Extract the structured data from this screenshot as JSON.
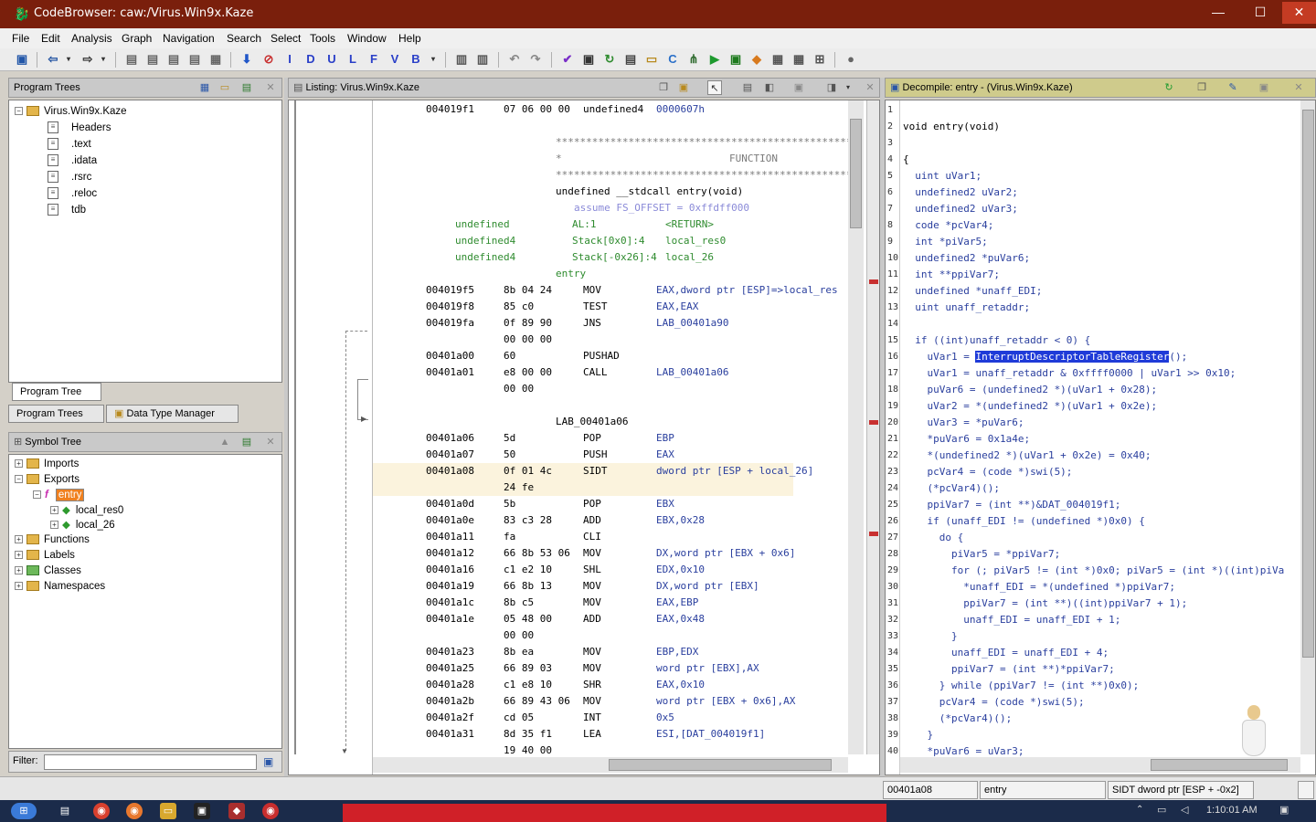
{
  "window": {
    "title": "CodeBrowser: caw:/Virus.Win9x.Kaze",
    "min_glyph": "—",
    "max_glyph": "☐",
    "close_glyph": "✕"
  },
  "menu": [
    "File",
    "Edit",
    "Analysis",
    "Graph",
    "Navigation",
    "Search",
    "Select",
    "Tools",
    "Window",
    "Help"
  ],
  "toolbar_letters": [
    "I",
    "D",
    "U",
    "L",
    "F",
    "V",
    "B"
  ],
  "program_trees": {
    "header": "Program Trees",
    "root": "Virus.Win9x.Kaze",
    "items": [
      "Headers",
      ".text",
      ".idata",
      ".rsrc",
      ".reloc",
      "tdb"
    ],
    "tab_program_tree": "Program Tree",
    "tab_program_trees": "Program Trees",
    "tab_data_type_manager": "Data Type Manager"
  },
  "symbol_tree": {
    "header": "Symbol Tree",
    "imports": "Imports",
    "exports": "Exports",
    "entry": "entry",
    "local1": "local_res0",
    "local2": "local_26",
    "functions": "Functions",
    "labels": "Labels",
    "classes": "Classes",
    "namespaces": "Namespaces",
    "filter_label": "Filter:"
  },
  "listing": {
    "header": "Listing:  Virus.Win9x.Kaze",
    "r0_addr": "004019f1",
    "r0_bytes": "07 06 00 00",
    "r0_mn": "undefined4",
    "r0_op": "0000607h",
    "stars": "****************************************************",
    "func_word": "FUNCTION",
    "sig": "undefined __stdcall entry(void)",
    "assume": "assume FS_OFFSET = 0xffdff000",
    "p1_type": "undefined",
    "p1_loc": "AL:1",
    "p1_name": "<RETURN>",
    "p2_type": "undefined4",
    "p2_loc": "Stack[0x0]:4",
    "p2_name": "local_res0",
    "p3_type": "undefined4",
    "p3_loc": "Stack[-0x26]:4",
    "p3_name": "local_26",
    "entry_label": "entry",
    "lab_label": "LAB_00401a06",
    "rows": [
      {
        "a": "004019f5",
        "b": "8b 04 24",
        "m": "MOV",
        "o": "EAX,dword ptr [ESP]=>local_res"
      },
      {
        "a": "004019f8",
        "b": "85 c0",
        "m": "TEST",
        "o": "EAX,EAX"
      },
      {
        "a": "004019fa",
        "b": "0f 89 90",
        "m": "JNS",
        "o": "LAB_00401a90"
      },
      {
        "a": "",
        "b": "00 00 00",
        "m": "",
        "o": ""
      },
      {
        "a": "00401a00",
        "b": "60",
        "m": "PUSHAD",
        "o": ""
      },
      {
        "a": "00401a01",
        "b": "e8 00 00",
        "m": "CALL",
        "o": "LAB_00401a06"
      },
      {
        "a": "",
        "b": "00 00",
        "m": "",
        "o": ""
      },
      {
        "a": "00401a06",
        "b": "5d",
        "m": "POP",
        "o": "EBP"
      },
      {
        "a": "00401a07",
        "b": "50",
        "m": "PUSH",
        "o": "EAX"
      },
      {
        "a": "00401a08",
        "b": "0f 01 4c",
        "m": "SIDT",
        "o": "dword ptr [ESP + local_26]"
      },
      {
        "a": "",
        "b": "24 fe",
        "m": "",
        "o": ""
      },
      {
        "a": "00401a0d",
        "b": "5b",
        "m": "POP",
        "o": "EBX"
      },
      {
        "a": "00401a0e",
        "b": "83 c3 28",
        "m": "ADD",
        "o": "EBX,0x28"
      },
      {
        "a": "00401a11",
        "b": "fa",
        "m": "CLI",
        "o": ""
      },
      {
        "a": "00401a12",
        "b": "66 8b 53 06",
        "m": "MOV",
        "o": "DX,word ptr [EBX + 0x6]"
      },
      {
        "a": "00401a16",
        "b": "c1 e2 10",
        "m": "SHL",
        "o": "EDX,0x10"
      },
      {
        "a": "00401a19",
        "b": "66 8b 13",
        "m": "MOV",
        "o": "DX,word ptr [EBX]"
      },
      {
        "a": "00401a1c",
        "b": "8b c5",
        "m": "MOV",
        "o": "EAX,EBP"
      },
      {
        "a": "00401a1e",
        "b": "05 48 00",
        "m": "ADD",
        "o": "EAX,0x48"
      },
      {
        "a": "",
        "b": "00 00",
        "m": "",
        "o": ""
      },
      {
        "a": "00401a23",
        "b": "8b ea",
        "m": "MOV",
        "o": "EBP,EDX"
      },
      {
        "a": "00401a25",
        "b": "66 89 03",
        "m": "MOV",
        "o": "word ptr [EBX],AX"
      },
      {
        "a": "00401a28",
        "b": "c1 e8 10",
        "m": "SHR",
        "o": "EAX,0x10"
      },
      {
        "a": "00401a2b",
        "b": "66 89 43 06",
        "m": "MOV",
        "o": "word ptr [EBX + 0x6],AX"
      },
      {
        "a": "00401a2f",
        "b": "cd 05",
        "m": "INT",
        "o": "0x5"
      },
      {
        "a": "00401a31",
        "b": "8d 35 f1",
        "m": "LEA",
        "o": "ESI,[DAT_004019f1]"
      },
      {
        "a": "",
        "b": "19 40 00",
        "m": "",
        "o": ""
      }
    ]
  },
  "decompile": {
    "header": "Decompile: entry -  (Virus.Win9x.Kaze)",
    "sel_text": "InterruptDescriptorTableRegister",
    "lines": [
      "",
      "void entry(void)",
      "",
      "{",
      "  uint uVar1;",
      "  undefined2 uVar2;",
      "  undefined2 uVar3;",
      "  code *pcVar4;",
      "  int *piVar5;",
      "  undefined2 *puVar6;",
      "  int **ppiVar7;",
      "  undefined *unaff_EDI;",
      "  uint unaff_retaddr;",
      "",
      "  if ((int)unaff_retaddr < 0) {",
      "    uVar1 = ",
      "    uVar1 = unaff_retaddr & 0xffff0000 | uVar1 >> 0x10;",
      "    puVar6 = (undefined2 *)(uVar1 + 0x28);",
      "    uVar2 = *(undefined2 *)(uVar1 + 0x2e);",
      "    uVar3 = *puVar6;",
      "    *puVar6 = 0x1a4e;",
      "    *(undefined2 *)(uVar1 + 0x2e) = 0x40;",
      "    pcVar4 = (code *)swi(5);",
      "    (*pcVar4)();",
      "    ppiVar7 = (int **)&DAT_004019f1;",
      "    if (unaff_EDI != (undefined *)0x0) {",
      "      do {",
      "        piVar5 = *ppiVar7;",
      "        for (; piVar5 != (int *)0x0; piVar5 = (int *)((int)piVa",
      "          *unaff_EDI = *(undefined *)ppiVar7;",
      "          ppiVar7 = (int **)((int)ppiVar7 + 1);",
      "          unaff_EDI = unaff_EDI + 1;",
      "        }",
      "        unaff_EDI = unaff_EDI + 4;",
      "        ppiVar7 = (int **)*ppiVar7;",
      "      } while (ppiVar7 != (int **)0x0);",
      "      pcVar4 = (code *)swi(5);",
      "      (*pcVar4)();",
      "    }",
      "    *puVar6 = uVar3;"
    ],
    "line16_tail": "();"
  },
  "status": {
    "address": "00401a08",
    "function": "entry",
    "instruction": "SIDT dword ptr [ESP + -0x2]",
    "clock": "1:10:01 AM"
  },
  "colors": {
    "titlebar": "#7a1f0c",
    "selection": "#1f3bd8",
    "operand": "#2a3f9e",
    "green": "#2e8b2e"
  }
}
